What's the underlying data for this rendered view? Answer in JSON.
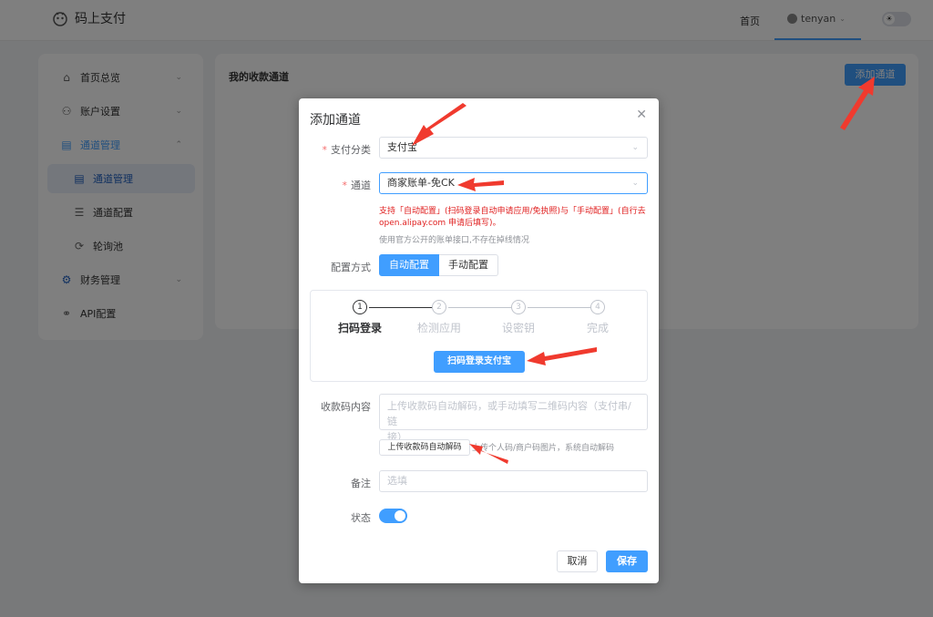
{
  "app": {
    "brand": "码上支付",
    "nav_home": "首页",
    "user": "tenyan",
    "theme_icon": "sun-icon"
  },
  "sidebar": {
    "items": [
      {
        "label": "首页总览",
        "icon": "home-icon"
      },
      {
        "label": "账户设置",
        "icon": "user-icon"
      },
      {
        "label": "通道管理",
        "icon": "channel-icon"
      },
      {
        "label": "通道管理",
        "icon": "list-icon"
      },
      {
        "label": "通道配置",
        "icon": "sliders-icon"
      },
      {
        "label": "轮询池",
        "icon": "poll-icon"
      },
      {
        "label": "财务管理",
        "icon": "gear-icon"
      },
      {
        "label": "API配置",
        "icon": "api-icon"
      }
    ]
  },
  "main": {
    "title": "我的收款通道",
    "add_button": "添加通道"
  },
  "dialog": {
    "title": "添加通道",
    "pay_category_label": "支付分类",
    "pay_category_value": "支付宝",
    "channel_label": "通道",
    "channel_value": "商家账单-免CK",
    "hint_red_1": "支持「自动配置」(扫码登录自动申请应用/免执照)与「手动配置」(自行去",
    "hint_red_2": "open.alipay.com 申请后填写)。",
    "hint_gray": "使用官方公开的账单接口,不存在掉线情况",
    "config_mode_label": "配置方式",
    "config_auto": "自动配置",
    "config_manual": "手动配置",
    "steps": [
      {
        "num": "1",
        "title": "扫码登录"
      },
      {
        "num": "2",
        "title": "检测应用"
      },
      {
        "num": "3",
        "title": "设密钥"
      },
      {
        "num": "4",
        "title": "完成"
      }
    ],
    "scan_button": "扫码登录支付宝",
    "qr_content_label": "收款码内容",
    "qr_content_placeholder_1": "上传收款码自动解码，或手动填写二维码内容（支付串/链",
    "qr_content_placeholder_2": "接）",
    "upload_button": "上传收款码自动解码",
    "upload_hint": "上传个人码/商户码图片，系统自动解码",
    "remark_label": "备注",
    "remark_placeholder": "选填",
    "status_label": "状态",
    "status_on": true,
    "cancel_button": "取消",
    "save_button": "保存"
  },
  "colors": {
    "primary": "#409eff",
    "danger": "#e02020",
    "annotation": "#f03a2e"
  }
}
